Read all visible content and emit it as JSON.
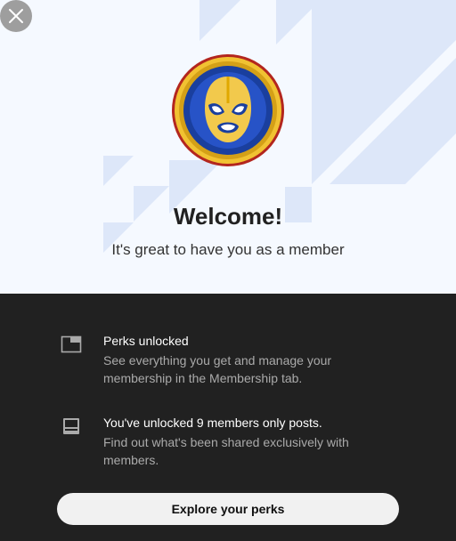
{
  "dialog": {
    "close_icon": "close-icon",
    "badge_icon": "luchador-mask-badge-icon",
    "title": "Welcome!",
    "subtitle": "It's great to have you as a member"
  },
  "perks": [
    {
      "icon": "membership-tab-icon",
      "title": "Perks unlocked",
      "description": "See everything you get and manage your membership in the Membership tab."
    },
    {
      "icon": "posts-icon",
      "title": "You've unlocked 9 members only posts.",
      "description": "Find out what's been shared exclusively with members."
    }
  ],
  "cta": {
    "label": "Explore your perks"
  },
  "colors": {
    "hero_background": "#f5f9ff",
    "stripe": "#dbe6f9",
    "panel_background": "#212121",
    "badge_gold": "#e0b52a",
    "badge_blue": "#1f3e9a",
    "mask_yellow": "#f2c94c"
  }
}
